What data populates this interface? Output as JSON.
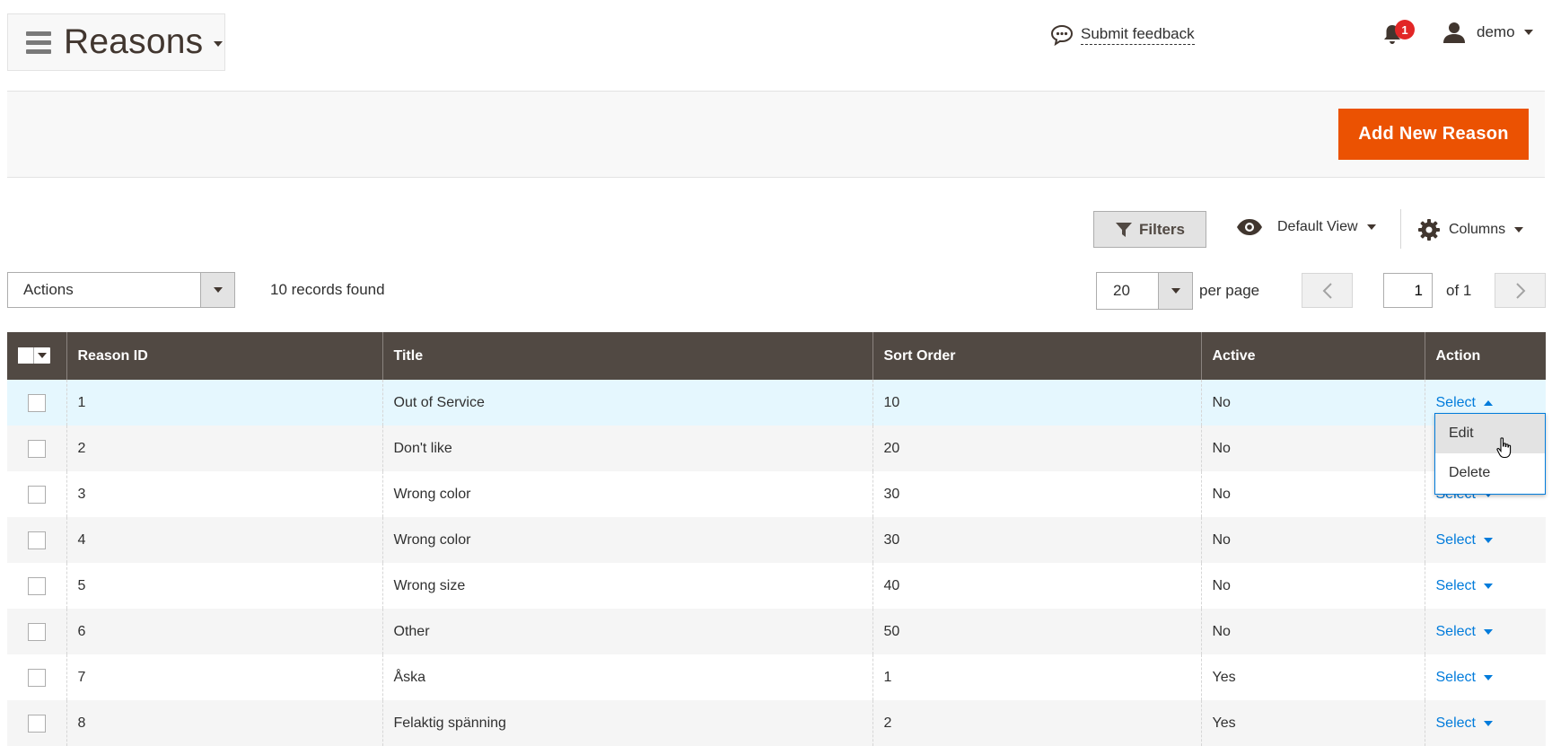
{
  "header": {
    "page_title": "Reasons",
    "feedback_label": "Submit feedback",
    "notification_count": "1",
    "username": "demo"
  },
  "action_bar": {
    "add_button_label": "Add New Reason"
  },
  "toolbar": {
    "filters_label": "Filters",
    "view_label": "Default View",
    "columns_label": "Columns"
  },
  "mass_actions": {
    "label": "Actions",
    "records_found": "10 records found"
  },
  "pagination": {
    "per_page_value": "20",
    "per_page_label": "per page",
    "current_page": "1",
    "total_label": "of 1"
  },
  "grid": {
    "columns": [
      "Reason ID",
      "Title",
      "Sort Order",
      "Active",
      "Action"
    ],
    "action_label": "Select",
    "rows": [
      {
        "id": "1",
        "title": "Out of Service",
        "sort": "10",
        "active": "No"
      },
      {
        "id": "2",
        "title": "Don't like",
        "sort": "20",
        "active": "No"
      },
      {
        "id": "3",
        "title": "Wrong color",
        "sort": "30",
        "active": "No"
      },
      {
        "id": "4",
        "title": "Wrong color",
        "sort": "30",
        "active": "No"
      },
      {
        "id": "5",
        "title": "Wrong size",
        "sort": "40",
        "active": "No"
      },
      {
        "id": "6",
        "title": "Other",
        "sort": "50",
        "active": "No"
      },
      {
        "id": "7",
        "title": "Åska",
        "sort": "1",
        "active": "Yes"
      },
      {
        "id": "8",
        "title": "Felaktig spänning",
        "sort": "2",
        "active": "Yes"
      }
    ]
  },
  "action_menu": {
    "items": [
      "Edit",
      "Delete"
    ]
  },
  "colors": {
    "accent": "#eb5202",
    "header_bg": "#514943",
    "link": "#007bdb",
    "badge": "#e22626",
    "active_row": "#e5f7fe"
  }
}
